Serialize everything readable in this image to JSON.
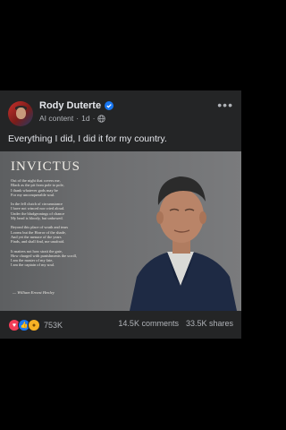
{
  "post": {
    "author": "Rody Duterte",
    "meta_label": "AI content",
    "separator": "·",
    "time": "1d",
    "caption": "Everything I did, I did it for my country."
  },
  "image": {
    "poem_title": "INVICTUS",
    "stanzas": [
      [
        "Out of the night that covers me,",
        "Black as the pit from pole to pole,",
        "I thank whatever gods may be",
        "For my unconquerable soul."
      ],
      [
        "In the fell clutch of circumstance",
        "I have not winced nor cried aloud.",
        "Under the bludgeonings of chance",
        "My head is bloody, but unbowed."
      ],
      [
        "Beyond this place of wrath and tears",
        "Looms but the Horror of the shade,",
        "And yet the menace of the years",
        "Finds, and shall find, me unafraid."
      ],
      [
        "It matters not how strait the gate,",
        "How charged with punishments the scroll,",
        "I am the master of my fate,",
        "I am the captain of my soul."
      ]
    ],
    "poem_author": "— William Ernest Henley"
  },
  "reactions": {
    "icons": [
      "love-icon",
      "like-icon",
      "care-icon"
    ],
    "count": "753K",
    "comments": "14.5K comments",
    "shares": "33.5K shares"
  }
}
